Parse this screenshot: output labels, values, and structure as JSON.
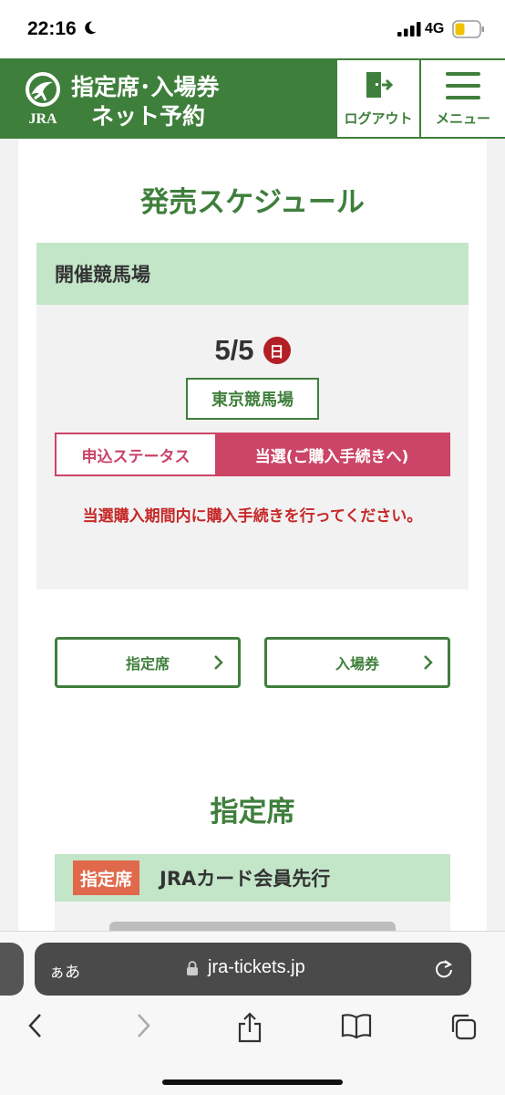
{
  "status_bar": {
    "time": "22:16",
    "network": "4G"
  },
  "header": {
    "title_line1": "指定席･入場券",
    "title_line2": "ネット予約",
    "logo_text": "JRA",
    "logout_label": "ログアウト",
    "menu_label": "メニュー"
  },
  "main": {
    "title": "発売スケジュール",
    "venue_header": "開催競馬場",
    "date": "5/5",
    "weekday": "日",
    "venue": "東京競馬場",
    "status_label": "申込ステータス",
    "status_value": "当選(ご購入手続きへ)",
    "notice": "当選購入期間内に購入手続きを行ってください。",
    "seat_button": "指定席",
    "ticket_button": "入場券",
    "section_title": "指定席",
    "section_tag": "指定席",
    "section_subtitle": "JRAカード会員先行"
  },
  "browser": {
    "aa": "ぁあ",
    "url": "jra-tickets.jp"
  },
  "colors": {
    "brand_green": "#3f7f3c",
    "light_green": "#c3e5c8",
    "status_pink": "#cc4466",
    "notice_red": "#c62828",
    "tag_orange": "#e0694c"
  }
}
